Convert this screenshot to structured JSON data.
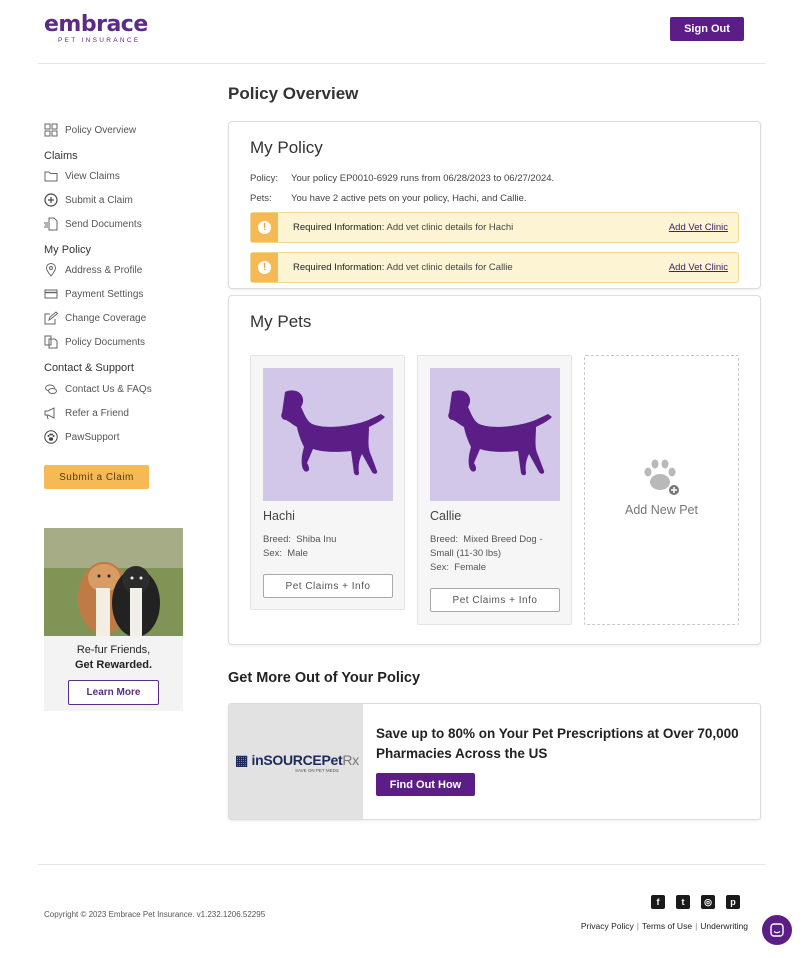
{
  "header": {
    "logo_text": "embrace",
    "logo_sub": "PET INSURANCE",
    "sign_out": "Sign Out"
  },
  "sidebar": {
    "overview": "Policy Overview",
    "claims_heading": "Claims",
    "view_claims": "View Claims",
    "submit_claim": "Submit a Claim",
    "send_documents": "Send Documents",
    "policy_heading": "My Policy",
    "address_profile": "Address & Profile",
    "payment_settings": "Payment Settings",
    "change_coverage": "Change Coverage",
    "policy_documents": "Policy Documents",
    "contact_heading": "Contact & Support",
    "contact_faqs": "Contact Us & FAQs",
    "refer_friend": "Refer a Friend",
    "pawsupport": "PawSupport",
    "submit_button": "Submit a Claim"
  },
  "promo": {
    "line1": "Re-fur Friends,",
    "line2": "Get Rewarded.",
    "button": "Learn More"
  },
  "page": {
    "title": "Policy Overview"
  },
  "policy": {
    "heading": "My Policy",
    "policy_label": "Policy:",
    "policy_text": "Your policy EP0010-6929 runs from 06/28/2023 to 06/27/2024.",
    "pets_label": "Pets:",
    "pets_text": "You have 2 active pets on your policy, Hachi, and Callie.",
    "alerts": [
      {
        "label": "Required Information:",
        "text": "Add vet clinic details for Hachi",
        "link": "Add Vet Clinic"
      },
      {
        "label": "Required Information:",
        "text": "Add vet clinic details for Callie",
        "link": "Add Vet Clinic"
      }
    ]
  },
  "pets": {
    "heading": "My Pets",
    "list": [
      {
        "name": "Hachi",
        "breed_label": "Breed:",
        "breed": "Shiba Inu",
        "sex_label": "Sex:",
        "sex": "Male",
        "button": "Pet Claims + Info"
      },
      {
        "name": "Callie",
        "breed_label": "Breed:",
        "breed": "Mixed Breed Dog - Small (11-30 lbs)",
        "sex_label": "Sex:",
        "sex": "Female",
        "button": "Pet Claims + Info"
      }
    ],
    "add_new": "Add New Pet"
  },
  "offers": {
    "heading": "Get More Out of Your Policy",
    "logo_text": "inSOURCEPet",
    "logo_suffix": "Rx",
    "logo_sub": "SAVE ON PET MEDS",
    "title": "Save up to 80% on Your Pet Prescriptions at Over 70,000 Pharmacies Across the US",
    "button": "Find Out How"
  },
  "footer": {
    "copyright": "Copyright © 2023   Embrace Pet Insurance. v1.232.1206.52295",
    "privacy": "Privacy Policy",
    "terms": "Terms of Use",
    "underwriting": "Underwriting"
  },
  "colors": {
    "brand_purple": "#5b1e87",
    "accent_yellow": "#f5b955",
    "pet_bg": "#d3c7e9"
  }
}
